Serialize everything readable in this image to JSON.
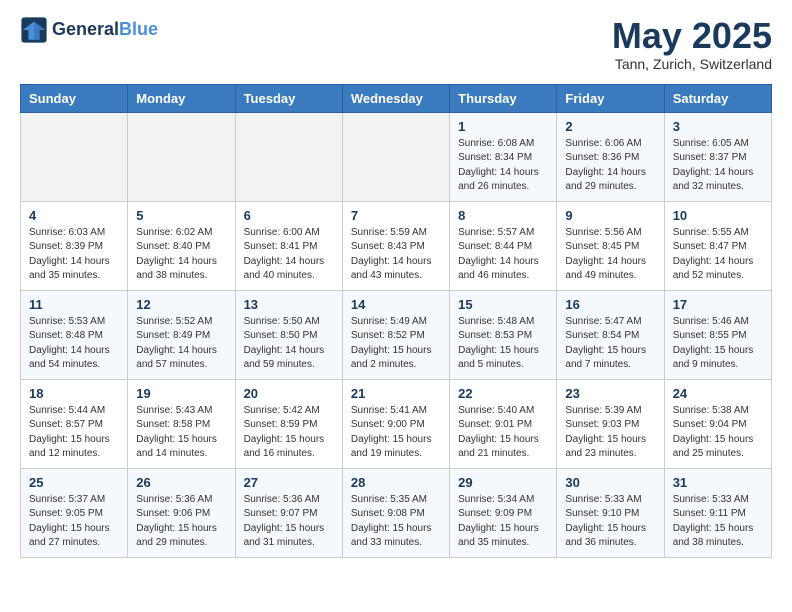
{
  "header": {
    "logo_line1": "General",
    "logo_line2": "Blue",
    "month_title": "May 2025",
    "location": "Tann, Zurich, Switzerland"
  },
  "weekdays": [
    "Sunday",
    "Monday",
    "Tuesday",
    "Wednesday",
    "Thursday",
    "Friday",
    "Saturday"
  ],
  "weeks": [
    [
      {
        "day": "",
        "empty": true
      },
      {
        "day": "",
        "empty": true
      },
      {
        "day": "",
        "empty": true
      },
      {
        "day": "",
        "empty": true
      },
      {
        "day": "1",
        "sunrise": "6:08 AM",
        "sunset": "8:34 PM",
        "daylight": "14 hours and 26 minutes."
      },
      {
        "day": "2",
        "sunrise": "6:06 AM",
        "sunset": "8:36 PM",
        "daylight": "14 hours and 29 minutes."
      },
      {
        "day": "3",
        "sunrise": "6:05 AM",
        "sunset": "8:37 PM",
        "daylight": "14 hours and 32 minutes."
      }
    ],
    [
      {
        "day": "4",
        "sunrise": "6:03 AM",
        "sunset": "8:39 PM",
        "daylight": "14 hours and 35 minutes."
      },
      {
        "day": "5",
        "sunrise": "6:02 AM",
        "sunset": "8:40 PM",
        "daylight": "14 hours and 38 minutes."
      },
      {
        "day": "6",
        "sunrise": "6:00 AM",
        "sunset": "8:41 PM",
        "daylight": "14 hours and 40 minutes."
      },
      {
        "day": "7",
        "sunrise": "5:59 AM",
        "sunset": "8:43 PM",
        "daylight": "14 hours and 43 minutes."
      },
      {
        "day": "8",
        "sunrise": "5:57 AM",
        "sunset": "8:44 PM",
        "daylight": "14 hours and 46 minutes."
      },
      {
        "day": "9",
        "sunrise": "5:56 AM",
        "sunset": "8:45 PM",
        "daylight": "14 hours and 49 minutes."
      },
      {
        "day": "10",
        "sunrise": "5:55 AM",
        "sunset": "8:47 PM",
        "daylight": "14 hours and 52 minutes."
      }
    ],
    [
      {
        "day": "11",
        "sunrise": "5:53 AM",
        "sunset": "8:48 PM",
        "daylight": "14 hours and 54 minutes."
      },
      {
        "day": "12",
        "sunrise": "5:52 AM",
        "sunset": "8:49 PM",
        "daylight": "14 hours and 57 minutes."
      },
      {
        "day": "13",
        "sunrise": "5:50 AM",
        "sunset": "8:50 PM",
        "daylight": "14 hours and 59 minutes."
      },
      {
        "day": "14",
        "sunrise": "5:49 AM",
        "sunset": "8:52 PM",
        "daylight": "15 hours and 2 minutes."
      },
      {
        "day": "15",
        "sunrise": "5:48 AM",
        "sunset": "8:53 PM",
        "daylight": "15 hours and 5 minutes."
      },
      {
        "day": "16",
        "sunrise": "5:47 AM",
        "sunset": "8:54 PM",
        "daylight": "15 hours and 7 minutes."
      },
      {
        "day": "17",
        "sunrise": "5:46 AM",
        "sunset": "8:55 PM",
        "daylight": "15 hours and 9 minutes."
      }
    ],
    [
      {
        "day": "18",
        "sunrise": "5:44 AM",
        "sunset": "8:57 PM",
        "daylight": "15 hours and 12 minutes."
      },
      {
        "day": "19",
        "sunrise": "5:43 AM",
        "sunset": "8:58 PM",
        "daylight": "15 hours and 14 minutes."
      },
      {
        "day": "20",
        "sunrise": "5:42 AM",
        "sunset": "8:59 PM",
        "daylight": "15 hours and 16 minutes."
      },
      {
        "day": "21",
        "sunrise": "5:41 AM",
        "sunset": "9:00 PM",
        "daylight": "15 hours and 19 minutes."
      },
      {
        "day": "22",
        "sunrise": "5:40 AM",
        "sunset": "9:01 PM",
        "daylight": "15 hours and 21 minutes."
      },
      {
        "day": "23",
        "sunrise": "5:39 AM",
        "sunset": "9:03 PM",
        "daylight": "15 hours and 23 minutes."
      },
      {
        "day": "24",
        "sunrise": "5:38 AM",
        "sunset": "9:04 PM",
        "daylight": "15 hours and 25 minutes."
      }
    ],
    [
      {
        "day": "25",
        "sunrise": "5:37 AM",
        "sunset": "9:05 PM",
        "daylight": "15 hours and 27 minutes."
      },
      {
        "day": "26",
        "sunrise": "5:36 AM",
        "sunset": "9:06 PM",
        "daylight": "15 hours and 29 minutes."
      },
      {
        "day": "27",
        "sunrise": "5:36 AM",
        "sunset": "9:07 PM",
        "daylight": "15 hours and 31 minutes."
      },
      {
        "day": "28",
        "sunrise": "5:35 AM",
        "sunset": "9:08 PM",
        "daylight": "15 hours and 33 minutes."
      },
      {
        "day": "29",
        "sunrise": "5:34 AM",
        "sunset": "9:09 PM",
        "daylight": "15 hours and 35 minutes."
      },
      {
        "day": "30",
        "sunrise": "5:33 AM",
        "sunset": "9:10 PM",
        "daylight": "15 hours and 36 minutes."
      },
      {
        "day": "31",
        "sunrise": "5:33 AM",
        "sunset": "9:11 PM",
        "daylight": "15 hours and 38 minutes."
      }
    ]
  ]
}
